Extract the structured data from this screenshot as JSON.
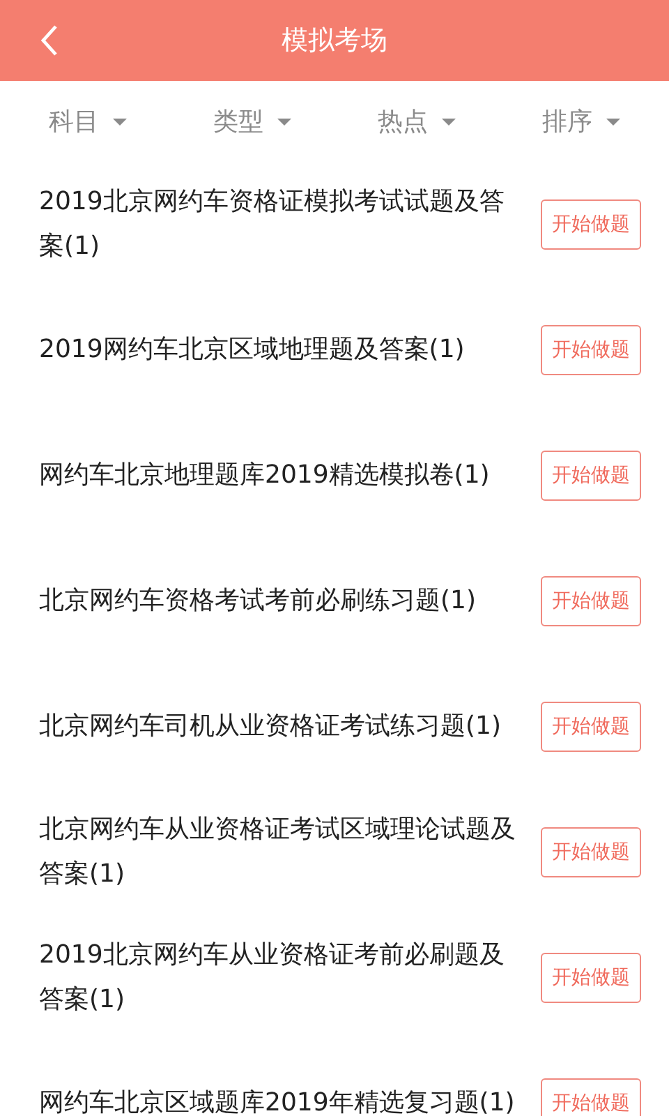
{
  "header": {
    "title": "模拟考场"
  },
  "filters": [
    {
      "label": "科目"
    },
    {
      "label": "类型"
    },
    {
      "label": "热点"
    },
    {
      "label": "排序"
    }
  ],
  "exams": [
    {
      "title": "2019北京网约车资格证模拟考试试题及答案(1)",
      "button": "开始做题"
    },
    {
      "title": "2019网约车北京区域地理题及答案(1)",
      "button": "开始做题"
    },
    {
      "title": "网约车北京地理题库2019精选模拟卷(1)",
      "button": "开始做题"
    },
    {
      "title": "北京网约车资格考试考前必刷练习题(1)",
      "button": "开始做题"
    },
    {
      "title": "北京网约车司机从业资格证考试练习题(1)",
      "button": "开始做题"
    },
    {
      "title": "北京网约车从业资格证考试区域理论试题及答案(1)",
      "button": "开始做题"
    },
    {
      "title": "2019北京网约车从业资格证考前必刷题及答案(1)",
      "button": "开始做题"
    },
    {
      "title": "网约车北京区域题库2019年精选复习题(1)",
      "button": "开始做题"
    }
  ]
}
